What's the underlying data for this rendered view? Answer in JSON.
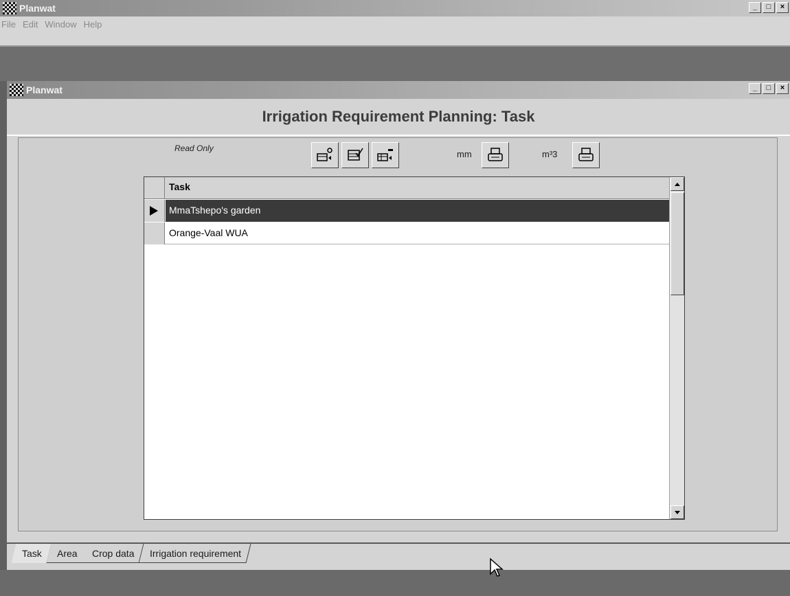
{
  "outer": {
    "title": "Planwat",
    "window_buttons": [
      "_",
      "□",
      "×"
    ],
    "menu": [
      "File",
      "Edit",
      "Window",
      "Help"
    ]
  },
  "child": {
    "title": "Planwat",
    "window_buttons": [
      "_",
      "□",
      "×"
    ],
    "heading": "Irrigation Requirement Planning: Task",
    "readonly_label": "Read Only",
    "unit_mm": "mm",
    "unit_m3": "m³3"
  },
  "grid": {
    "column": "Task",
    "rows": [
      {
        "task": "MmaTshepo's garden",
        "selected": true
      },
      {
        "task": "Orange-Vaal WUA",
        "selected": false
      }
    ]
  },
  "tabs": [
    {
      "label": "Task",
      "active": true
    },
    {
      "label": "Area",
      "active": false
    },
    {
      "label": "Crop data",
      "active": false
    },
    {
      "label": "Irrigation requirement",
      "active": false
    }
  ],
  "colors": {
    "selection": "#3a3a3a",
    "panel": "#d4d4d4"
  }
}
